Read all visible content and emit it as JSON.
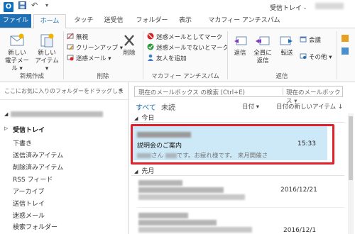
{
  "titlebar": {
    "app_icon": "outlook-icon",
    "app_icon_letter": "O",
    "save_glyph": "💾",
    "undo_glyph": "↶",
    "customize_glyph": "▾",
    "title": "受信トレイ -"
  },
  "tabs": {
    "file": "ファイル",
    "home": "ホーム",
    "touch": "タッチ",
    "send_receive": "送受信",
    "folder": "フォルダー",
    "view": "表示",
    "mcafee": "マカフィー アンチスパム"
  },
  "ribbon": {
    "new_group": {
      "label": "新規作成",
      "new_email": "新しい\n電子メール",
      "new_email_l1": "新しい",
      "new_email_l2": "電子メール ▾",
      "new_items_l1": "新しい",
      "new_items_l2": "アイテム ▾"
    },
    "delete_group": {
      "label": "削除",
      "ignore": "無視",
      "cleanup": "クリーンアップ ▾",
      "junk": "迷惑メール ▾",
      "delete": "削除"
    },
    "mcafee_group": {
      "label": "マカフィー アンチスパム",
      "mark_junk": "迷惑メールとしてマーク",
      "mark_not_junk": "迷惑メールでないとマーク",
      "add_friend": "友人を追加"
    },
    "respond_group": {
      "label": "返信",
      "reply": "返信",
      "reply_all_l1": "全員に",
      "reply_all_l2": "返信",
      "forward": "転送",
      "meeting": "会議",
      "more": "その他 ▾"
    }
  },
  "folder_pane": {
    "favorites_hint": "ここにお気に入りのフォルダーをドラッグしま",
    "collapse": "◂",
    "account_caret": "◢",
    "folders": [
      "受信トレイ",
      "下書き",
      "送信済みアイテム",
      "削除済みアイテム",
      "RSS フィード",
      "アーカイブ",
      "送信トレイ",
      "迷惑メール",
      "検索フォルダー"
    ],
    "inbox_caret": "▷"
  },
  "message_list": {
    "search_placeholder": "現在のメールボックス の検索 (Ctrl+E)",
    "search_icon": "search-icon",
    "search_scope": "現在のメールボックス ▾",
    "filter_all": "すべて",
    "filter_unread": "未読",
    "sort_by": "日付 ▾",
    "sort_order": "日付の新しいアイテム ↓",
    "scroll_up": "▲",
    "group_today": "今日",
    "group_last_month": "先月",
    "group_toggle": "◢",
    "selected_message": {
      "subject": "説明会のご案内",
      "time": "15:33",
      "preview_mid": "さん",
      "preview_text": "です。お疲れ様です。 来月開催さ"
    },
    "older_messages": [
      {
        "date": "2016/12/21"
      },
      {
        "date": "2016/12/1"
      }
    ]
  },
  "colors": {
    "accent": "#1f6fb5",
    "selection": "#cde8f6",
    "highlight": "#e0202a"
  }
}
